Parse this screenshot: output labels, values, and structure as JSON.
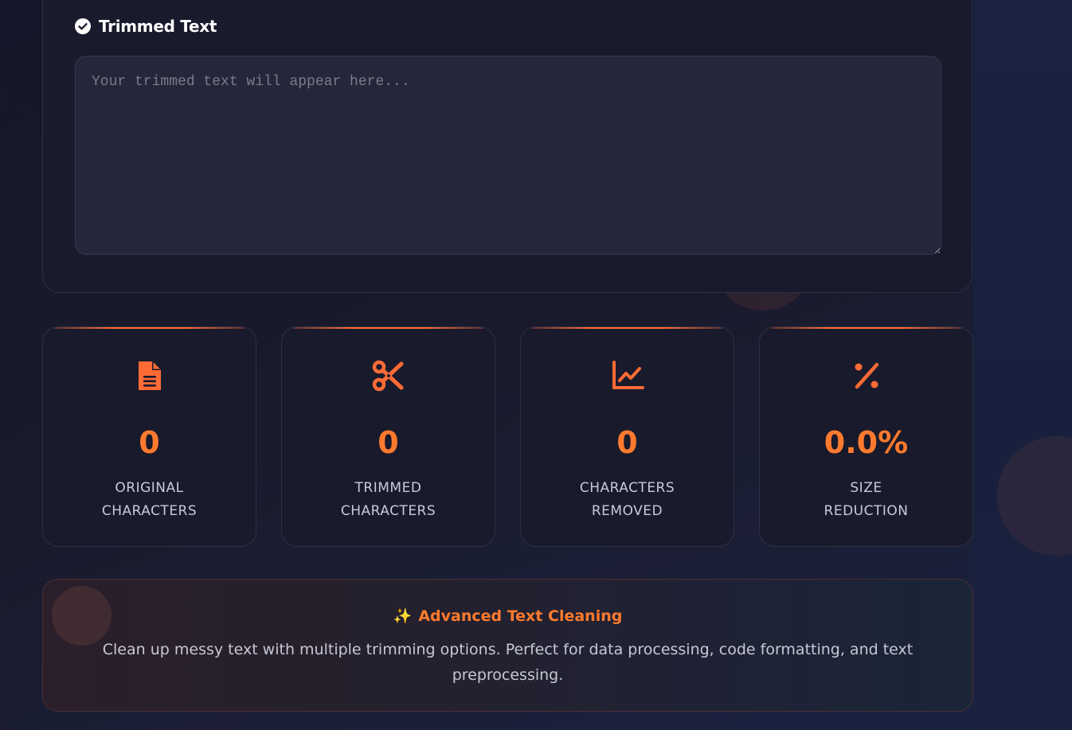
{
  "output": {
    "title": "Trimmed Text",
    "placeholder": "Your trimmed text will appear here...",
    "value": ""
  },
  "stats": [
    {
      "icon": "document-icon",
      "value": "0",
      "label": "Original Characters"
    },
    {
      "icon": "scissors-icon",
      "value": "0",
      "label": "Trimmed Characters"
    },
    {
      "icon": "chart-line-icon",
      "value": "0",
      "label": "Characters Removed"
    },
    {
      "icon": "percent-icon",
      "value": "0.0%",
      "label": "Size Reduction"
    }
  ],
  "info": {
    "sparkle": "✨",
    "title": "Advanced Text Cleaning",
    "description": "Clean up messy text with multiple trimming options. Perfect for data processing, code formatting, and text preprocessing."
  },
  "colors": {
    "accent": "#ff7a2e",
    "background": "#191a2b",
    "textarea": "#25263a"
  }
}
